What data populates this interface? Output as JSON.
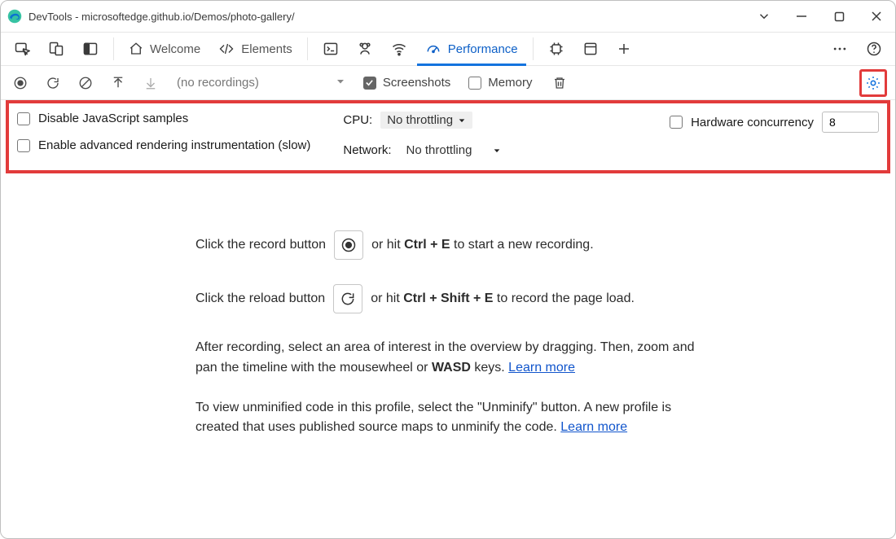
{
  "window": {
    "title": "DevTools - microsoftedge.github.io/Demos/photo-gallery/"
  },
  "tabs": {
    "welcome": "Welcome",
    "elements": "Elements",
    "performance": "Performance"
  },
  "perf_toolbar": {
    "placeholder": "(no recordings)",
    "screenshots_label": "Screenshots",
    "memory_label": "Memory"
  },
  "settings": {
    "disable_js_label": "Disable JavaScript samples",
    "advanced_rendering_label": "Enable advanced rendering instrumentation (slow)",
    "cpu_label": "CPU:",
    "cpu_value": "No throttling",
    "network_label": "Network:",
    "network_value": "No throttling",
    "hw_concurrency_label": "Hardware concurrency",
    "hw_concurrency_value": "8"
  },
  "help": {
    "line1_a": "Click the record button",
    "line1_b": "or hit ",
    "line1_kbd": "Ctrl + E",
    "line1_c": " to start a new recording.",
    "line2_a": "Click the reload button",
    "line2_b": "or hit ",
    "line2_kbd": "Ctrl + Shift + E",
    "line2_c": " to record the page load.",
    "para1_a": "After recording, select an area of interest in the overview by dragging. Then, zoom and pan the timeline with the mousewheel or ",
    "para1_wasd": "WASD",
    "para1_b": " keys. ",
    "learn_more": "Learn more",
    "para2_a": "To view unminified code in this profile, select the \"Unminify\" button. A new profile is created that uses published source maps to unminify the code. "
  }
}
